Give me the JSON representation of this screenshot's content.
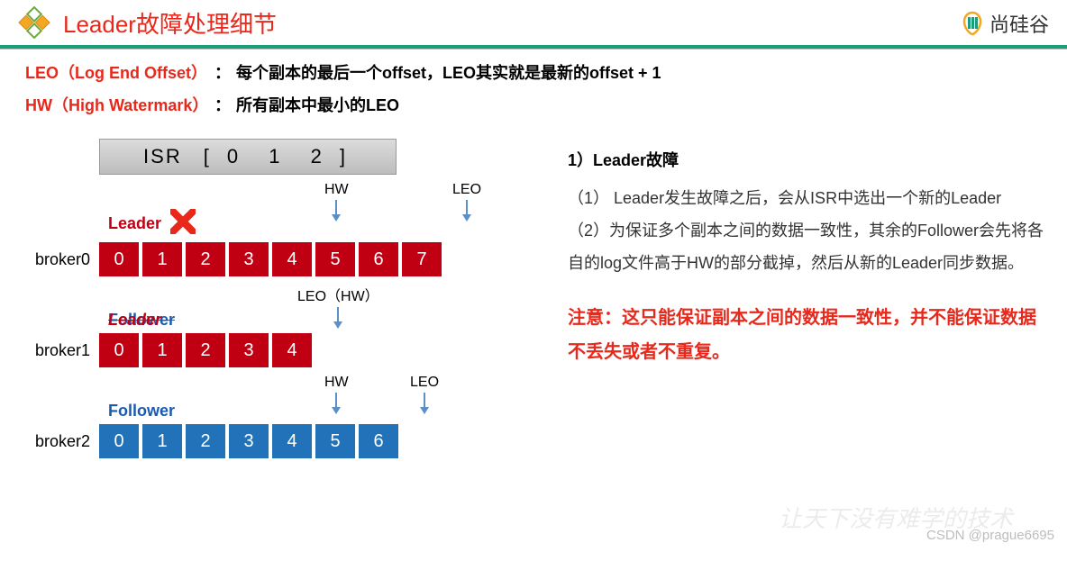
{
  "header": {
    "title": "Leader故障处理细节",
    "brand_text": "尚硅谷"
  },
  "definitions": {
    "leo_term": "LEO（Log End Offset）",
    "leo_desc": "每个副本的最后一个offset，LEO其实就是最新的offset + 1",
    "hw_term": "HW（High Watermark）",
    "hw_desc": "所有副本中最小的LEO"
  },
  "isr": {
    "label": "ISR",
    "open": "[",
    "ids": [
      "0",
      "1",
      "2"
    ],
    "close": "]"
  },
  "brokers": [
    {
      "name": "broker0",
      "role": "Leader",
      "role_style": "leader",
      "color": "red",
      "offsets": [
        "0",
        "1",
        "2",
        "3",
        "4",
        "5",
        "6",
        "7"
      ],
      "markers": {
        "hw_label": "HW",
        "hw_at": 5,
        "leo_label": "LEO",
        "leo_at": 8
      }
    },
    {
      "name": "broker1",
      "role_base": "Follower",
      "role_overlay": "Leader",
      "role_style": "newleader",
      "color": "red",
      "offsets": [
        "0",
        "1",
        "2",
        "3",
        "4"
      ],
      "markers": {
        "combo_label": "LEO（HW）",
        "combo_at": 5
      }
    },
    {
      "name": "broker2",
      "role": "Follower",
      "role_style": "follower",
      "color": "blue",
      "offsets": [
        "0",
        "1",
        "2",
        "3",
        "4",
        "5",
        "6"
      ],
      "markers": {
        "hw_label": "HW",
        "hw_at": 5,
        "leo_label": "LEO",
        "leo_at": 7
      }
    }
  ],
  "right": {
    "heading": "1）Leader故障",
    "p1": "（1） Leader发生故障之后，会从ISR中选出一个新的Leader",
    "p2": "（2）为保证多个副本之间的数据一致性，其余的Follower会先将各自的log文件高于HW的部分截掉，然后从新的Leader同步数据。",
    "warning": "注意：这只能保证副本之间的数据一致性，并不能保证数据不丢失或者不重复。"
  },
  "watermark": {
    "br": "CSDN @prague6695",
    "bg": "让天下没有难学的技术"
  },
  "colors": {
    "red": "#c00012",
    "blue": "#2172b8",
    "green": "#1b9c7b",
    "accent_red": "#e8281b"
  }
}
